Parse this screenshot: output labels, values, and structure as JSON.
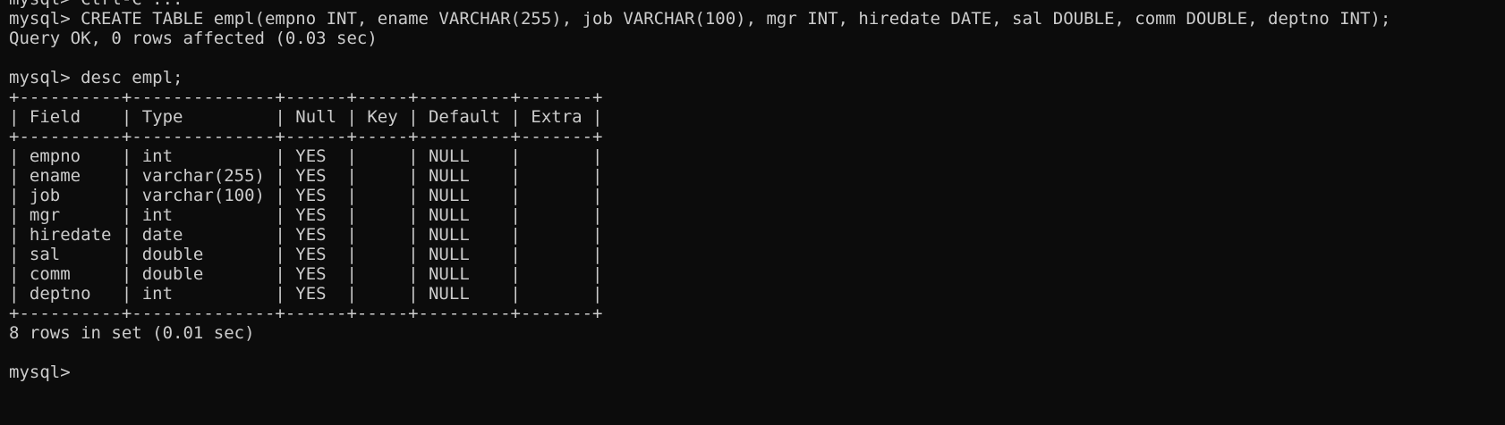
{
  "terminal": {
    "background": "#0c0c0c",
    "foreground": "#cccccc",
    "lines": [
      "mysql> Ctrl-C ...",
      "mysql> CREATE TABLE empl(empno INT, ename VARCHAR(255), job VARCHAR(100), mgr INT, hiredate DATE, sal DOUBLE, comm DOUBLE, deptno INT);",
      "Query OK, 0 rows affected (0.03 sec)",
      "",
      "mysql> desc empl;",
      "+----------+--------------+------+-----+---------+-------+",
      "| Field    | Type         | Null | Key | Default | Extra |",
      "+----------+--------------+------+-----+---------+-------+",
      "| empno    | int          | YES  |     | NULL    |       |",
      "| ename    | varchar(255) | YES  |     | NULL    |       |",
      "| job      | varchar(100) | YES  |     | NULL    |       |",
      "| mgr      | int          | YES  |     | NULL    |       |",
      "| hiredate | date         | YES  |     | NULL    |       |",
      "| sal      | double       | YES  |     | NULL    |       |",
      "| comm     | double       | YES  |     | NULL    |       |",
      "| deptno   | int          | YES  |     | NULL    |       |",
      "+----------+--------------+------+-----+---------+-------+",
      "8 rows in set (0.01 sec)",
      "",
      "mysql> "
    ]
  }
}
